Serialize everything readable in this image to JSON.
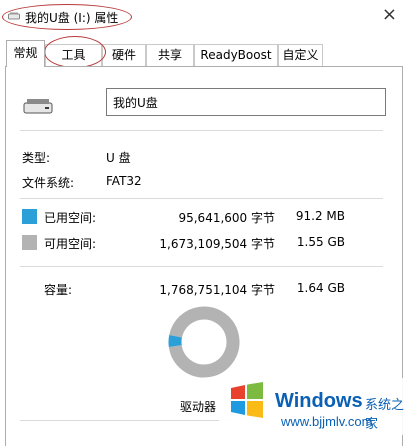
{
  "window": {
    "title": "我的U盘 (I:) 属性",
    "close_glyph": "×"
  },
  "tabs": [
    {
      "label": "常规",
      "active": true
    },
    {
      "label": "工具"
    },
    {
      "label": "硬件"
    },
    {
      "label": "共享"
    },
    {
      "label": "ReadyBoost"
    },
    {
      "label": "自定义"
    }
  ],
  "general": {
    "volume_label": "我的U盘",
    "type_label": "类型:",
    "type_value": "U 盘",
    "fs_label": "文件系统:",
    "fs_value": "FAT32",
    "used": {
      "label": "已用空间:",
      "bytes": "95,641,600 字节",
      "size": "91.2 MB",
      "color": "#2a9fd8"
    },
    "free": {
      "label": "可用空间:",
      "bytes": "1,673,109,504 字节",
      "size": "1.55 GB",
      "color": "#b3b3b3"
    },
    "capacity": {
      "label": "容量:",
      "bytes": "1,768,751,104 字节",
      "size": "1.64 GB"
    },
    "drive_text": "驱动器"
  },
  "chart_data": {
    "type": "pie",
    "categories": [
      "已用空间",
      "可用空间"
    ],
    "values": [
      95641600,
      1673109504
    ],
    "colors": [
      "#2a9fd8",
      "#b3b3b3"
    ]
  },
  "watermark": {
    "brand": "Windows",
    "cn": "系统之家",
    "url": "www.bjjmlv.com"
  }
}
